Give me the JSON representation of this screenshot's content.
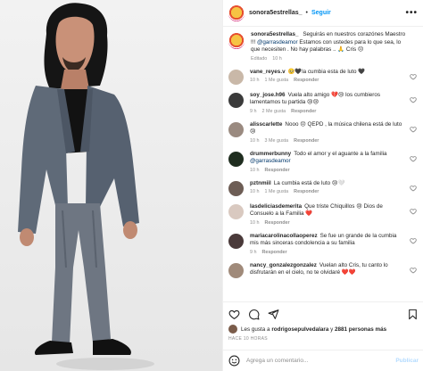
{
  "header": {
    "username": "sonora5estrellas_",
    "separator": "•",
    "follow_label": "Seguir",
    "more_label": "•••"
  },
  "caption": {
    "username": "sonora5estrellas_",
    "text": "Seguirás en nuestros corazónes Maestro !!!",
    "mention": "@garrasdeamor",
    "text2": "Estamos con ustedes para lo que sea, lo que necesiten . No hay palabras .. 🙏 Cris 😔",
    "edited": "Editado",
    "time": "10 h"
  },
  "comments": [
    {
      "username": "vane_reyes.v",
      "text": "🥺🖤la cumbia esta de luto 🖤",
      "time": "10 h",
      "likes": "1 Me gusta",
      "reply": "Responder",
      "avatar_color": "#c9b8a8"
    },
    {
      "username": "soy_jose.h96",
      "text": "Vuela alto amigo 💔😢 los cumbieros lamentamos tu partida 😢😢",
      "time": "9 h",
      "likes": "2 Me gusta",
      "reply": "Responder",
      "avatar_color": "#3b3b3b"
    },
    {
      "username": "alisscarlette",
      "text": "Nooo 😔 QEPD , la música chilena está de luto 😢",
      "time": "10 h",
      "likes": "3 Me gusta",
      "reply": "Responder",
      "avatar_color": "#9a8a80"
    },
    {
      "username": "drummerbunny",
      "text": "Todo el amor y el aguante a la familia",
      "mention": "@garrasdeamor",
      "time": "10 h",
      "likes": "",
      "reply": "Responder",
      "avatar_color": "#1f2d1f"
    },
    {
      "username": "pztnmiil",
      "text": "La cumbia está de luto 😢🤍",
      "time": "10 h",
      "likes": "1 Me gusta",
      "reply": "Responder",
      "avatar_color": "#6d5d55"
    },
    {
      "username": "lasdeliciasdemerita",
      "text": "Que triste Chiquillos 😢 Dios de Consuelo a la Familia ❤️",
      "time": "10 h",
      "likes": "",
      "reply": "Responder",
      "avatar_color": "#d9c9c0"
    },
    {
      "username": "mariacarolinacollaoperez",
      "text": "Se fue un grande de la cumbia mis más sinceras condolencia a su familia",
      "time": "9 h",
      "likes": "",
      "reply": "Responder",
      "avatar_color": "#4a3a3a"
    },
    {
      "username": "nancy_gonzalezgonzalez",
      "text": "Vuelan alto Cris, tu canto lo disfrutarán en el cielo, no te olvidaré ❤️❤️",
      "time": "",
      "likes": "",
      "reply": "",
      "avatar_color": "#a08a7a"
    }
  ],
  "footer": {
    "likes_prefix": "Les gusta a",
    "likes_user": "rodrigosepulvedalara",
    "likes_mid": "y",
    "likes_count": "2881 personas más",
    "age": "HACE 10 HORAS",
    "comment_placeholder": "Agrega un comentario...",
    "post_label": "Publicar"
  },
  "colors": {
    "link_blue": "#0095f6",
    "mention_blue": "#00376b",
    "muted": "#8e8e8e"
  }
}
